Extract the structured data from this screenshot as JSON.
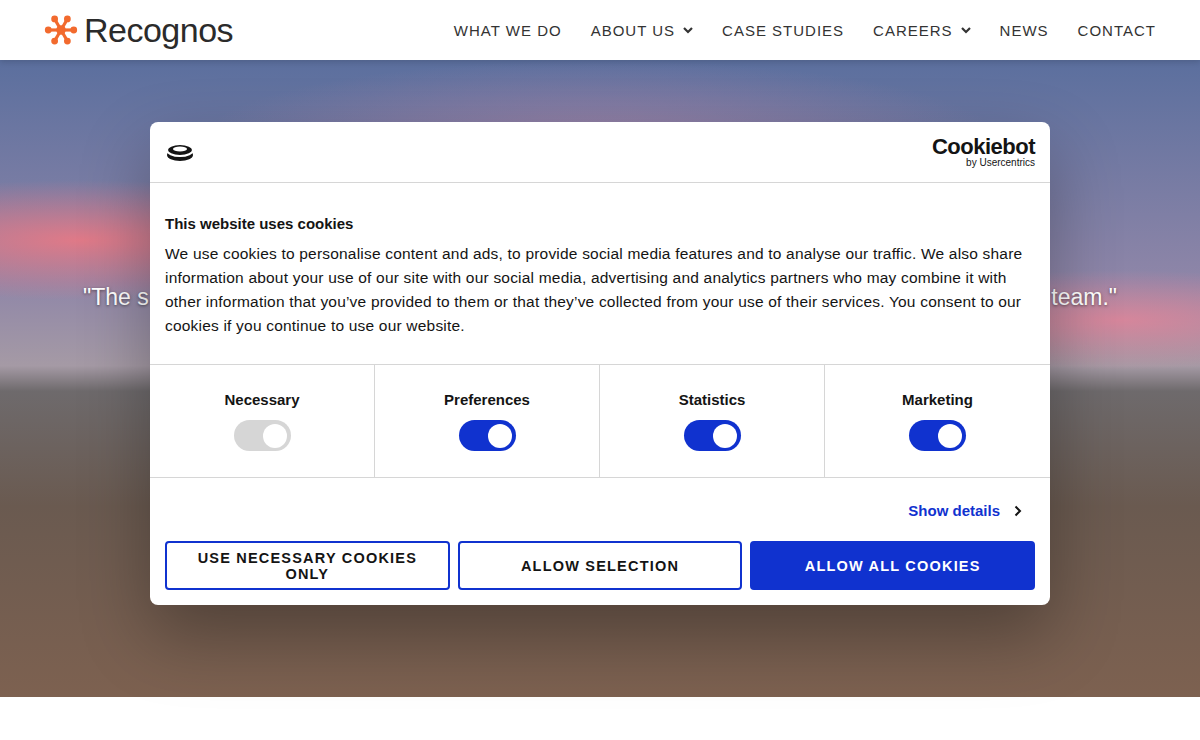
{
  "header": {
    "logo": "Recognos",
    "nav": [
      {
        "label": "WHAT WE DO",
        "dropdown": false
      },
      {
        "label": "ABOUT US",
        "dropdown": true
      },
      {
        "label": "CASE STUDIES",
        "dropdown": false
      },
      {
        "label": "CAREERS",
        "dropdown": true
      },
      {
        "label": "NEWS",
        "dropdown": false
      },
      {
        "label": "CONTACT",
        "dropdown": false
      }
    ]
  },
  "hero": {
    "quote_left": "\"The s",
    "quote_right": "team.\""
  },
  "cookie_dialog": {
    "brand": "Cookiebot",
    "brand_sub": "by Usercentrics",
    "title": "This website uses cookies",
    "body": "We use cookies to personalise content and ads, to provide social media features and to analyse our traffic. We also share information about your use of our site with our social media, advertising and analytics partners who may combine it with other information that you’ve provided to them or that they’ve collected from your use of their services. You consent to our cookies if you continue to use our website.",
    "categories": [
      {
        "label": "Necessary",
        "on": true,
        "disabled": true
      },
      {
        "label": "Preferences",
        "on": true,
        "disabled": false
      },
      {
        "label": "Statistics",
        "on": true,
        "disabled": false
      },
      {
        "label": "Marketing",
        "on": true,
        "disabled": false
      }
    ],
    "details_link": "Show details",
    "buttons": [
      {
        "label": "USE NECESSARY COOKIES ONLY",
        "primary": false
      },
      {
        "label": "ALLOW SELECTION",
        "primary": false
      },
      {
        "label": "ALLOW ALL COOKIES",
        "primary": true
      }
    ]
  }
}
